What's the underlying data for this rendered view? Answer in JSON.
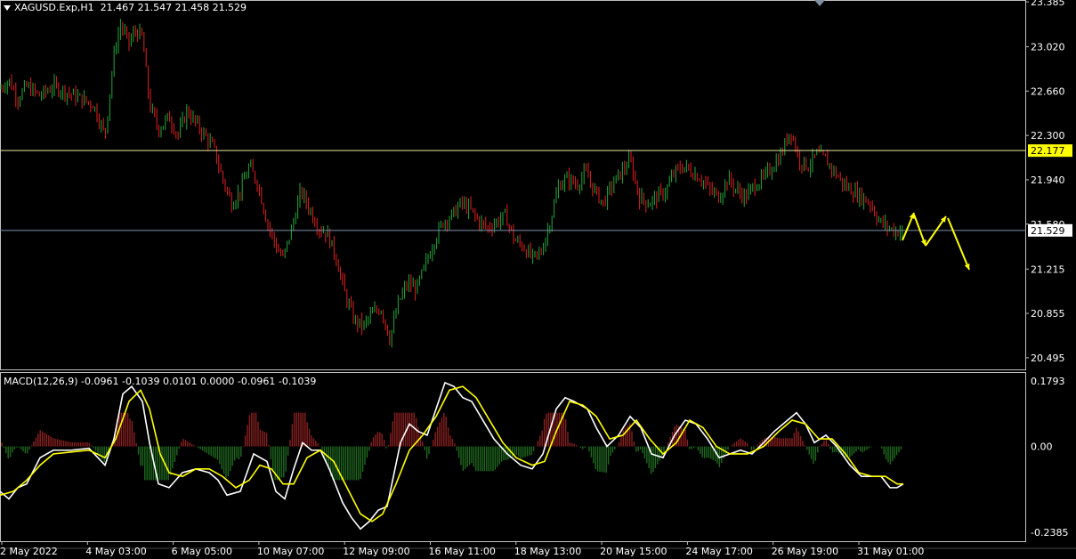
{
  "header": {
    "symbol": "XAGUSD.Exp,H1",
    "ohlc": "21.467 21.547 21.458 21.529"
  },
  "indicator": {
    "label": "MACD(12,26,9) -0.0961 -0.1039 0.0101 0.0000 -0.0961 -0.1039"
  },
  "colors": {
    "background": "#000000",
    "bull": "#22a83a",
    "bear": "#e02020",
    "level_line": "#e8e8a0",
    "price_line": "#8090b0",
    "arrow": "#ffff00",
    "macd_main": "#ffffff",
    "macd_signal": "#ffff00",
    "hist_pos": "#8b2020",
    "hist_neg": "#1f6a1f"
  },
  "chart_data": [
    {
      "type": "candlestick",
      "ylim": [
        20.4,
        23.4
      ],
      "price_ticks": [
        "23.385",
        "23.020",
        "22.660",
        "22.300",
        "21.940",
        "21.580",
        "21.215",
        "20.855",
        "20.495"
      ],
      "level_label": "22.177",
      "level_value": 22.177,
      "price_label": "21.529",
      "price_value": 21.529,
      "x_labels": [
        "2 May 2022",
        "4 May 03:00",
        "6 May 05:00",
        "10 May 07:00",
        "12 May 09:00",
        "16 May 11:00",
        "18 May 13:00",
        "20 May 15:00",
        "24 May 17:00",
        "26 May 19:00",
        "31 May 01:00"
      ],
      "close_path": [
        [
          0,
          22.68
        ],
        [
          10,
          22.75
        ],
        [
          20,
          22.6
        ],
        [
          30,
          22.7
        ],
        [
          45,
          22.62
        ],
        [
          60,
          22.7
        ],
        [
          75,
          22.65
        ],
        [
          90,
          22.6
        ],
        [
          105,
          22.55
        ],
        [
          118,
          22.3
        ],
        [
          128,
          22.95
        ],
        [
          135,
          23.2
        ],
        [
          145,
          23.05
        ],
        [
          152,
          23.15
        ],
        [
          160,
          23.1
        ],
        [
          168,
          22.55
        ],
        [
          178,
          22.35
        ],
        [
          190,
          22.45
        ],
        [
          200,
          22.3
        ],
        [
          210,
          22.5
        ],
        [
          220,
          22.4
        ],
        [
          230,
          22.3
        ],
        [
          240,
          22.2
        ],
        [
          250,
          21.95
        ],
        [
          260,
          21.75
        ],
        [
          270,
          21.85
        ],
        [
          280,
          22.05
        ],
        [
          290,
          21.9
        ],
        [
          300,
          21.6
        ],
        [
          310,
          21.4
        ],
        [
          318,
          21.3
        ],
        [
          328,
          21.55
        ],
        [
          338,
          21.85
        ],
        [
          348,
          21.7
        ],
        [
          358,
          21.55
        ],
        [
          368,
          21.5
        ],
        [
          378,
          21.3
        ],
        [
          388,
          21.0
        ],
        [
          398,
          20.8
        ],
        [
          408,
          20.75
        ],
        [
          418,
          20.85
        ],
        [
          428,
          20.9
        ],
        [
          438,
          20.65
        ],
        [
          448,
          20.95
        ],
        [
          458,
          21.1
        ],
        [
          468,
          21.05
        ],
        [
          478,
          21.25
        ],
        [
          488,
          21.45
        ],
        [
          498,
          21.6
        ],
        [
          508,
          21.65
        ],
        [
          518,
          21.75
        ],
        [
          528,
          21.7
        ],
        [
          538,
          21.6
        ],
        [
          548,
          21.55
        ],
        [
          558,
          21.6
        ],
        [
          568,
          21.65
        ],
        [
          578,
          21.45
        ],
        [
          588,
          21.4
        ],
        [
          598,
          21.3
        ],
        [
          608,
          21.35
        ],
        [
          618,
          21.6
        ],
        [
          628,
          21.9
        ],
        [
          638,
          21.95
        ],
        [
          648,
          21.9
        ],
        [
          658,
          22.0
        ],
        [
          668,
          21.85
        ],
        [
          678,
          21.75
        ],
        [
          688,
          21.9
        ],
        [
          698,
          22.0
        ],
        [
          708,
          22.1
        ],
        [
          718,
          21.8
        ],
        [
          728,
          21.75
        ],
        [
          738,
          21.8
        ],
        [
          748,
          21.85
        ],
        [
          758,
          22.0
        ],
        [
          768,
          22.05
        ],
        [
          778,
          22.0
        ],
        [
          788,
          21.95
        ],
        [
          798,
          21.85
        ],
        [
          808,
          21.8
        ],
        [
          818,
          21.95
        ],
        [
          828,
          21.85
        ],
        [
          838,
          21.8
        ],
        [
          848,
          21.9
        ],
        [
          858,
          21.95
        ],
        [
          868,
          22.05
        ],
        [
          878,
          22.15
        ],
        [
          888,
          22.35
        ],
        [
          898,
          22.1
        ],
        [
          908,
          22.05
        ],
        [
          918,
          22.15
        ],
        [
          928,
          22.1
        ],
        [
          938,
          22.0
        ],
        [
          948,
          21.9
        ],
        [
          958,
          21.85
        ],
        [
          968,
          21.8
        ],
        [
          978,
          21.75
        ],
        [
          988,
          21.6
        ],
        [
          998,
          21.55
        ],
        [
          1008,
          21.52
        ],
        [
          1015,
          21.53
        ]
      ]
    },
    {
      "type": "line",
      "title": "MACD(12,26,9)",
      "ylim": [
        -0.2385,
        0.1793
      ],
      "ticks": [
        "0.1793",
        "0.00",
        "-0.2385"
      ],
      "series": [
        {
          "values": [
            [
              0,
              -0.12
            ],
            [
              10,
              -0.14
            ],
            [
              20,
              -0.11
            ],
            [
              30,
              -0.1
            ],
            [
              45,
              -0.03
            ],
            [
              60,
              -0.01
            ],
            [
              80,
              -0.01
            ],
            [
              100,
              -0.005
            ],
            [
              118,
              -0.05
            ],
            [
              128,
              0.02
            ],
            [
              138,
              0.14
            ],
            [
              148,
              0.16
            ],
            [
              160,
              0.12
            ],
            [
              168,
              0.01
            ],
            [
              178,
              -0.1
            ],
            [
              190,
              -0.11
            ],
            [
              205,
              -0.07
            ],
            [
              220,
              -0.06
            ],
            [
              235,
              -0.07
            ],
            [
              245,
              -0.09
            ],
            [
              255,
              -0.13
            ],
            [
              270,
              -0.12
            ],
            [
              285,
              -0.02
            ],
            [
              300,
              -0.04
            ],
            [
              310,
              -0.12
            ],
            [
              320,
              -0.14
            ],
            [
              330,
              -0.06
            ],
            [
              340,
              0.01
            ],
            [
              350,
              -0.01
            ],
            [
              360,
              -0.01
            ],
            [
              370,
              -0.06
            ],
            [
              385,
              -0.15
            ],
            [
              395,
              -0.19
            ],
            [
              405,
              -0.22
            ],
            [
              415,
              -0.2
            ],
            [
              425,
              -0.17
            ],
            [
              435,
              -0.16
            ],
            [
              450,
              0.01
            ],
            [
              460,
              0.06
            ],
            [
              470,
              0.04
            ],
            [
              480,
              0.03
            ],
            [
              490,
              0.1
            ],
            [
              500,
              0.17
            ],
            [
              510,
              0.16
            ],
            [
              520,
              0.13
            ],
            [
              530,
              0.12
            ],
            [
              540,
              0.08
            ],
            [
              555,
              0.02
            ],
            [
              570,
              -0.02
            ],
            [
              585,
              -0.05
            ],
            [
              598,
              -0.06
            ],
            [
              610,
              -0.02
            ],
            [
              625,
              0.1
            ],
            [
              635,
              0.13
            ],
            [
              645,
              0.12
            ],
            [
              660,
              0.1
            ],
            [
              670,
              0.05
            ],
            [
              682,
              0.0
            ],
            [
              695,
              0.03
            ],
            [
              708,
              0.08
            ],
            [
              720,
              0.05
            ],
            [
              732,
              -0.02
            ],
            [
              745,
              -0.03
            ],
            [
              758,
              0.03
            ],
            [
              770,
              0.07
            ],
            [
              782,
              0.06
            ],
            [
              795,
              0.02
            ],
            [
              808,
              -0.03
            ],
            [
              820,
              -0.02
            ],
            [
              832,
              -0.01
            ],
            [
              845,
              -0.02
            ],
            [
              858,
              0.01
            ],
            [
              870,
              0.04
            ],
            [
              885,
              0.07
            ],
            [
              895,
              0.09
            ],
            [
              905,
              0.06
            ],
            [
              915,
              0.01
            ],
            [
              928,
              0.03
            ],
            [
              940,
              0.0
            ],
            [
              955,
              -0.05
            ],
            [
              968,
              -0.08
            ],
            [
              980,
              -0.08
            ],
            [
              990,
              -0.08
            ],
            [
              1000,
              -0.11
            ],
            [
              1008,
              -0.11
            ],
            [
              1015,
              -0.1
            ]
          ]
        },
        {
          "values": [
            [
              0,
              -0.13
            ],
            [
              15,
              -0.12
            ],
            [
              30,
              -0.09
            ],
            [
              45,
              -0.05
            ],
            [
              60,
              -0.02
            ],
            [
              80,
              -0.015
            ],
            [
              100,
              -0.01
            ],
            [
              118,
              -0.03
            ],
            [
              130,
              0.02
            ],
            [
              145,
              0.12
            ],
            [
              158,
              0.15
            ],
            [
              168,
              0.1
            ],
            [
              180,
              -0.02
            ],
            [
              190,
              -0.07
            ],
            [
              205,
              -0.08
            ],
            [
              220,
              -0.06
            ],
            [
              235,
              -0.06
            ],
            [
              250,
              -0.08
            ],
            [
              265,
              -0.11
            ],
            [
              280,
              -0.09
            ],
            [
              292,
              -0.05
            ],
            [
              305,
              -0.06
            ],
            [
              318,
              -0.1
            ],
            [
              330,
              -0.1
            ],
            [
              345,
              -0.03
            ],
            [
              360,
              -0.01
            ],
            [
              375,
              -0.04
            ],
            [
              390,
              -0.11
            ],
            [
              405,
              -0.18
            ],
            [
              418,
              -0.2
            ],
            [
              430,
              -0.18
            ],
            [
              445,
              -0.1
            ],
            [
              460,
              -0.01
            ],
            [
              475,
              0.03
            ],
            [
              490,
              0.08
            ],
            [
              505,
              0.15
            ],
            [
              520,
              0.16
            ],
            [
              535,
              0.13
            ],
            [
              550,
              0.07
            ],
            [
              565,
              0.01
            ],
            [
              580,
              -0.03
            ],
            [
              598,
              -0.05
            ],
            [
              612,
              -0.04
            ],
            [
              625,
              0.04
            ],
            [
              640,
              0.12
            ],
            [
              655,
              0.11
            ],
            [
              670,
              0.08
            ],
            [
              685,
              0.02
            ],
            [
              700,
              0.03
            ],
            [
              715,
              0.07
            ],
            [
              730,
              0.02
            ],
            [
              745,
              -0.02
            ],
            [
              760,
              0.01
            ],
            [
              775,
              0.07
            ],
            [
              790,
              0.05
            ],
            [
              805,
              0.0
            ],
            [
              820,
              -0.02
            ],
            [
              840,
              -0.02
            ],
            [
              858,
              0.0
            ],
            [
              875,
              0.04
            ],
            [
              890,
              0.07
            ],
            [
              905,
              0.06
            ],
            [
              920,
              0.02
            ],
            [
              935,
              0.02
            ],
            [
              950,
              -0.02
            ],
            [
              965,
              -0.07
            ],
            [
              980,
              -0.08
            ],
            [
              995,
              -0.08
            ],
            [
              1008,
              -0.1
            ],
            [
              1015,
              -0.1
            ]
          ]
        }
      ]
    }
  ]
}
